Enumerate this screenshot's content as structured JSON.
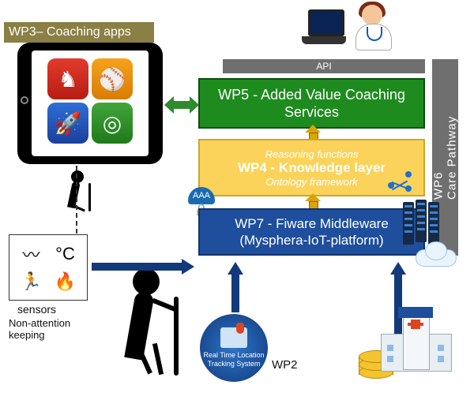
{
  "wp3": {
    "title": "WP3– Coaching apps"
  },
  "api": {
    "label": "API"
  },
  "wp5": {
    "label": "WP5 - Added Value Coaching Services"
  },
  "wp4": {
    "line1": "Reasoning functions",
    "line2": "WP4 - Knowledge layer",
    "line3": "Ontology framework"
  },
  "wp7": {
    "label": "WP7 - Fiware Middleware (Mysphera-IoT-platform)"
  },
  "wp6": {
    "label": "WP6\nCare Pathway"
  },
  "aaa": {
    "label": "AAA"
  },
  "sensors": {
    "label": "sensors",
    "note": "Non-attention keeping"
  },
  "rtls": {
    "line1": "Real Time Location",
    "line2": "Tracking System"
  },
  "wp2": {
    "label": "WP2"
  },
  "icons": {
    "apps": [
      "♞",
      "⚾",
      "🚀",
      "◎"
    ],
    "sensor_glyphs": [
      "〰",
      "°C",
      "🏃",
      "🔥"
    ]
  },
  "colors": {
    "wp5": "#1e8b1e",
    "wp4": "#fbd35a",
    "wp7": "#1e4e9c",
    "grey": "#6f6f6f",
    "arrow": "#123a7a"
  },
  "chart_data": {
    "type": "diagram",
    "nodes": [
      {
        "id": "wp3",
        "label": "WP3 – Coaching apps"
      },
      {
        "id": "wp5",
        "label": "WP5 - Added Value Coaching Services"
      },
      {
        "id": "wp4",
        "label": "WP4 - Knowledge layer",
        "sub": [
          "Reasoning functions",
          "Ontology framework"
        ]
      },
      {
        "id": "wp7",
        "label": "WP7 - Fiware Middleware (Mysphera-IoT-platform)",
        "badge": "AAA"
      },
      {
        "id": "wp6",
        "label": "WP6 Care Pathway"
      },
      {
        "id": "api",
        "label": "API"
      },
      {
        "id": "sensors",
        "label": "sensors",
        "note": "Non-attention keeping"
      },
      {
        "id": "wp2",
        "label": "WP2",
        "sub": [
          "Real Time Location Tracking System"
        ]
      },
      {
        "id": "elderly_user"
      },
      {
        "id": "clinician"
      },
      {
        "id": "laptop"
      },
      {
        "id": "cloud_servers"
      },
      {
        "id": "hospital"
      },
      {
        "id": "database"
      }
    ],
    "edges": [
      {
        "from": "wp3",
        "to": "wp5",
        "dir": "both"
      },
      {
        "from": "api",
        "to": "wp5",
        "dir": "down"
      },
      {
        "from": "wp4",
        "to": "wp5",
        "dir": "up"
      },
      {
        "from": "wp7",
        "to": "wp4",
        "dir": "up"
      },
      {
        "from": "sensors",
        "to": "wp7",
        "dir": "right"
      },
      {
        "from": "wp2",
        "to": "wp7",
        "dir": "up"
      },
      {
        "from": "hospital",
        "to": "wp7",
        "dir": "up",
        "via": "database"
      },
      {
        "from": "elderly_user",
        "to": "sensors",
        "style": "dotted"
      },
      {
        "from": "elderly_user",
        "to": "wp3",
        "style": "dotted"
      }
    ]
  }
}
